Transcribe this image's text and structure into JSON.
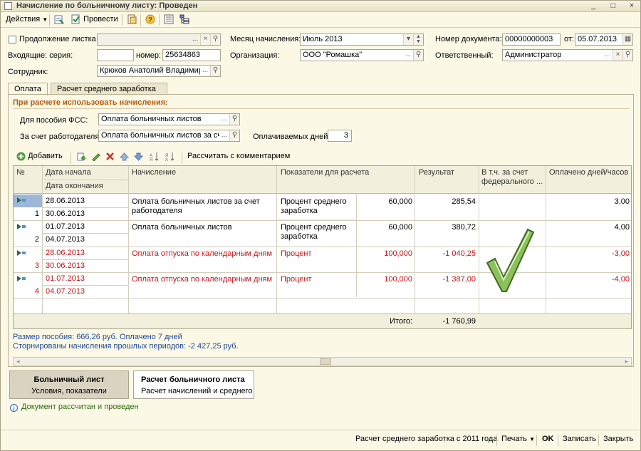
{
  "window": {
    "title": "Начисление по больничному листу: Проведен",
    "min": "_",
    "max": "□",
    "close": "×"
  },
  "toolbar": {
    "actions": "Действия",
    "post": "Провести"
  },
  "header": {
    "continuation_label": "Продолжение листка",
    "month_label": "Месяц начисления:",
    "month_value": "Июль 2013",
    "docnum_label": "Номер документа:",
    "docnum_value": "00000000003",
    "from_label": "от:",
    "date_value": "05.07.2013",
    "incoming_series_label": "Входящие: серия:",
    "number_label": "номер:",
    "number_value": "25634863",
    "org_label": "Организация:",
    "org_value": "ООО \"Ромашка\"",
    "resp_label": "Ответственный:",
    "resp_value": "Администратор",
    "employee_label": "Сотрудник:",
    "employee_value": "Крюков Анатолий Владимиро"
  },
  "tabs": [
    "Оплата",
    "Расчет среднего заработка"
  ],
  "section": {
    "title": "При расчете использовать начисления:",
    "fss_label": "Для пособия ФСС:",
    "fss_value": "Оплата больничных листов",
    "employer_label": "За счет работодателя:",
    "employer_value": "Оплата больничных листов за сче",
    "paid_days_label": "Оплачиваемых дней:",
    "paid_days_value": "3"
  },
  "gridtoolbar": {
    "add": "Добавить",
    "calc_comment": "Рассчитать с комментарием"
  },
  "grid": {
    "headers": {
      "num": "№",
      "start": "Дата начала",
      "end": "Дата окончания",
      "accrual": "Начисление",
      "indicators": "Показатели для расчета",
      "result": "Результат",
      "federal": "В т.ч. за счет федерального ...",
      "paid_days": "Оплачено дней/часов"
    },
    "rows": [
      {
        "num": "1",
        "start": "28.06.2013",
        "end": "30.06.2013",
        "accrual": "Оплата больничных листов за счет работодателя",
        "ind_name": "Процент среднего заработка",
        "ind_value": "60,000",
        "result": "285,54",
        "federal": "",
        "paid": "3,00"
      },
      {
        "num": "2",
        "start": "01.07.2013",
        "end": "04.07.2013",
        "accrual": "Оплата больничных листов",
        "ind_name": "Процент среднего заработка",
        "ind_value": "60,000",
        "result": "380,72",
        "federal": "",
        "paid": "4,00"
      },
      {
        "num": "3",
        "start": "28.06.2013",
        "end": "30.06.2013",
        "accrual": "Оплата отпуска по календарным дням",
        "ind_name": "Процент",
        "ind_value": "100,000",
        "result": "-1 040,25",
        "federal": "",
        "paid": "-3,00"
      },
      {
        "num": "4",
        "start": "01.07.2013",
        "end": "04.07.2013",
        "accrual": "Оплата отпуска по календарным дням",
        "ind_name": "Процент",
        "ind_value": "100,000",
        "result": "-1 387,00",
        "federal": "",
        "paid": "-4,00"
      }
    ],
    "total_label": "Итого:",
    "total_value": "-1 760,99"
  },
  "info": {
    "line1": "Размер пособия: 666,26 руб. Оплачено 7 дней",
    "line2": "Сторнированы начисления прошлых периодов: -2 427,25 руб."
  },
  "bottom_tabs": [
    {
      "title": "Больничный лист",
      "subtitle": "Условия, показатели"
    },
    {
      "title": "Расчет больничного листа",
      "subtitle": "Расчет начислений и среднего"
    }
  ],
  "status_message": "Документ рассчитан и проведен",
  "footer": {
    "avg_calc": "Расчет среднего заработка с 2011 года",
    "print": "Печать",
    "ok": "OK",
    "save": "Записать",
    "close": "Закрыть"
  },
  "colors": {
    "accent_orange": "#b55a0c",
    "storno_red": "#c0161b",
    "info_blue": "#1e4a96",
    "checkmark_green": "#4e9a2a"
  }
}
